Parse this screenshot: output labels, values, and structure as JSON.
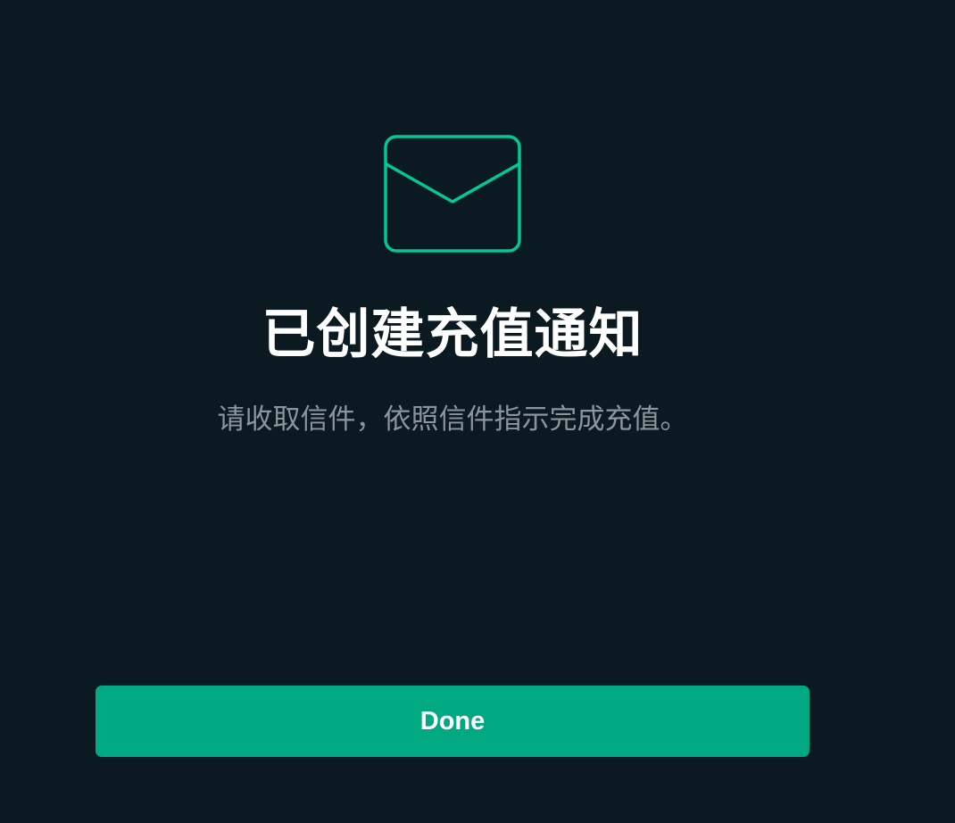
{
  "dialog": {
    "icon": "envelope-icon",
    "title": "已创建充值通知",
    "subtitle": "请收取信件，依照信件指示完成充值。",
    "done_label": "Done"
  },
  "colors": {
    "background": "#0b1921",
    "accent": "#00c896",
    "button": "#00a982",
    "title": "#ffffff",
    "subtitle": "#8b969c"
  }
}
